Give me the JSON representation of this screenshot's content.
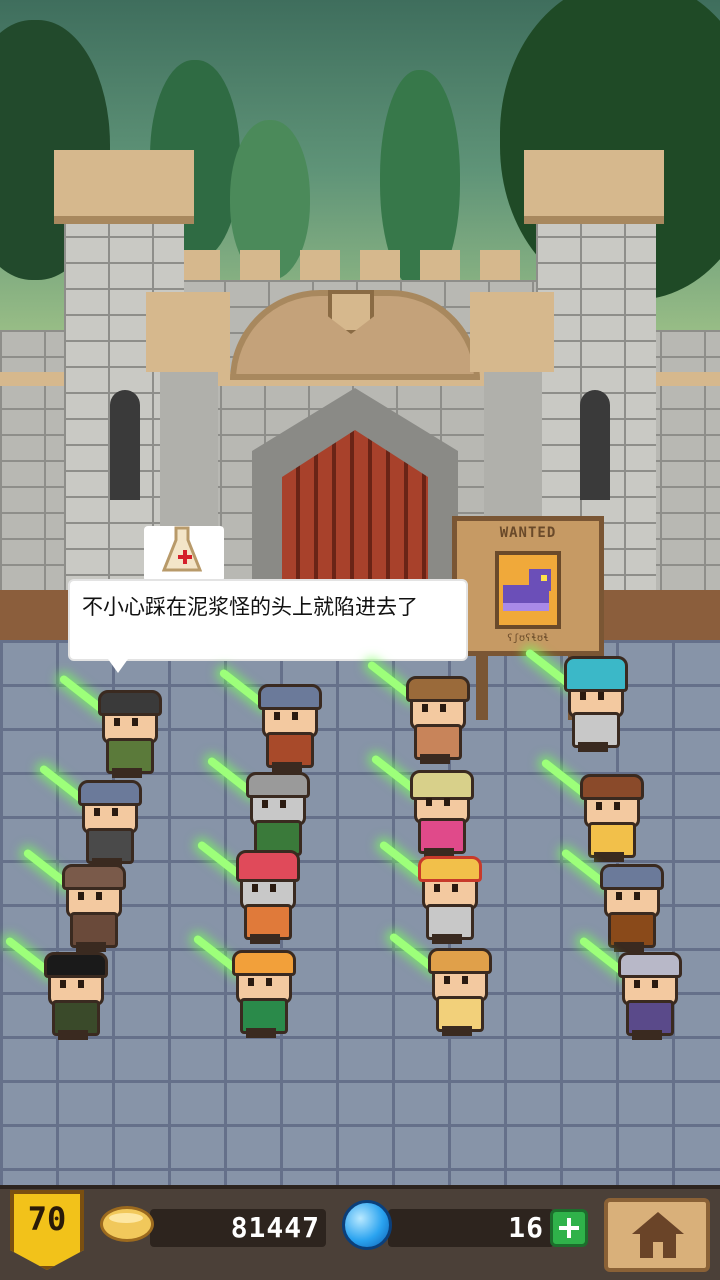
{
  "dialog": {
    "text": "不小心踩在泥浆怪的头上就陷进去了"
  },
  "wanted_board": {
    "title": "WANTED",
    "footer": "ʕʃʊʕɬʊɬ"
  },
  "status_bar": {
    "level": "70",
    "gold": "81447",
    "gems": "16"
  },
  "icons": {
    "level": "shield-badge",
    "gold": "gold-coin-icon",
    "gems": "blue-gem-icon",
    "add_gems": "plus-icon",
    "home": "home-icon",
    "alert": "flask-alert-icon"
  },
  "colors": {
    "accent_gold": "#f2c21a",
    "saber_green": "#9dff7a",
    "plus_green": "#2fb24a"
  }
}
